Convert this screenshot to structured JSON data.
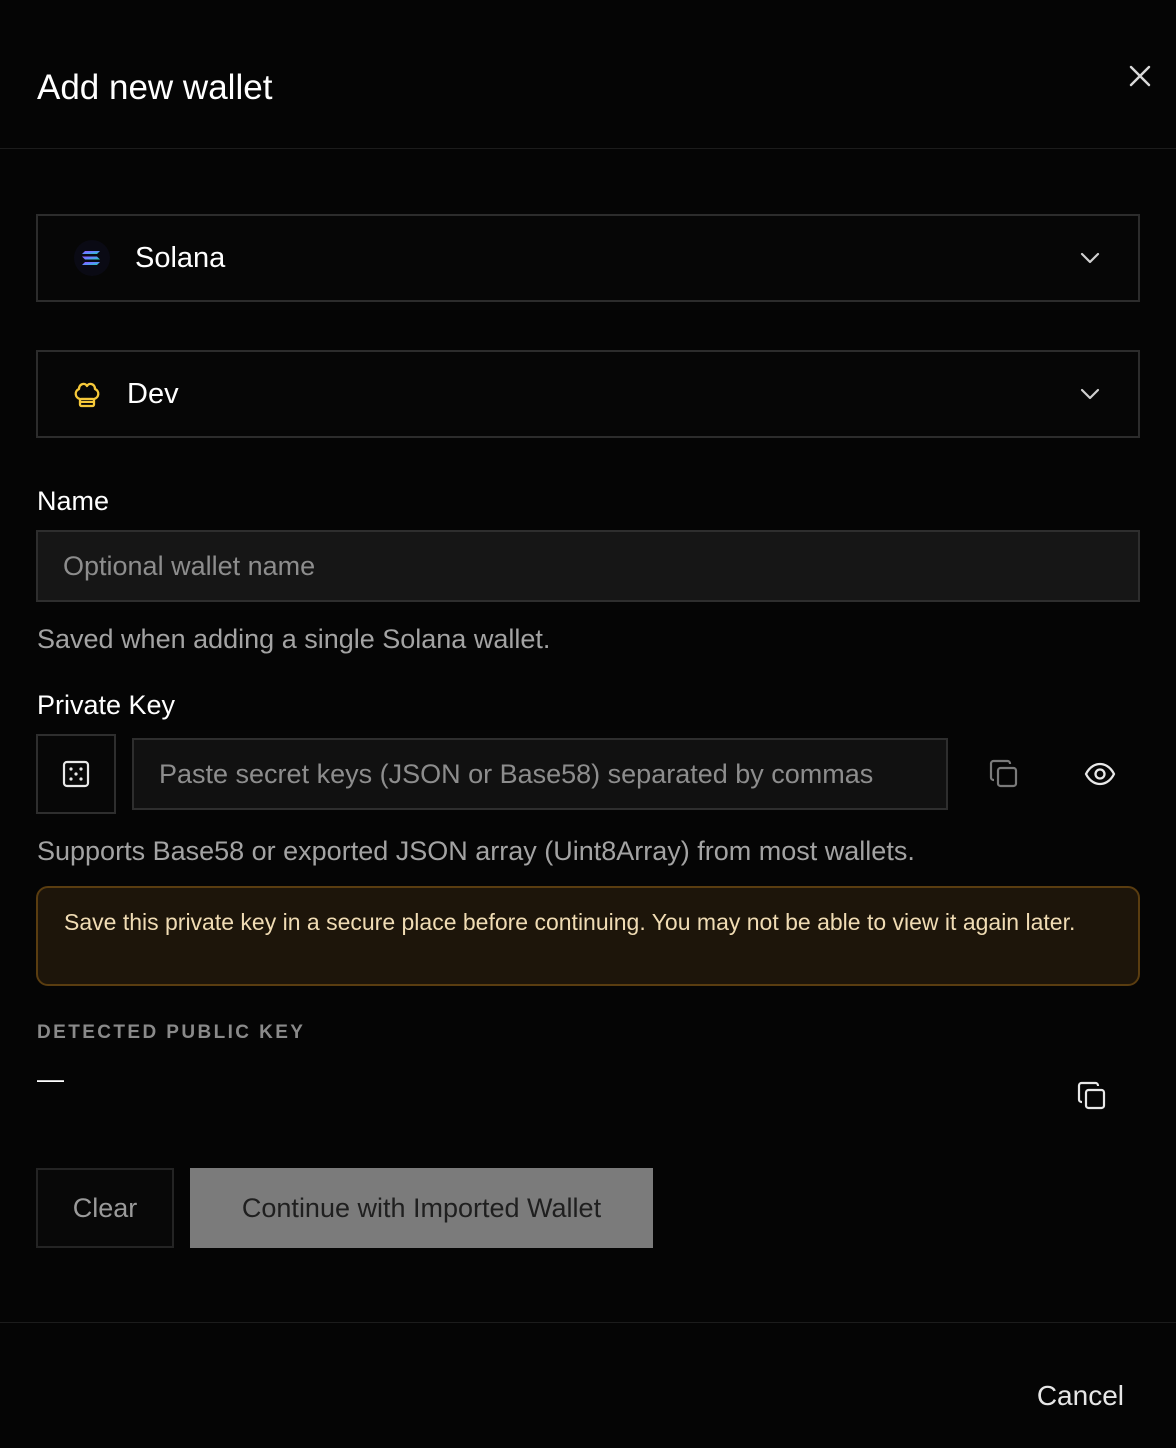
{
  "dialog": {
    "title": "Add new wallet",
    "close_icon": "close-icon"
  },
  "chain_select": {
    "selected": "Solana",
    "icon": "solana-logo-icon",
    "chevron_icon": "chevron-down-icon"
  },
  "profile_select": {
    "selected": "Dev",
    "icon": "chef-hat-icon",
    "icon_color": "#f5c83a",
    "chevron_icon": "chevron-down-icon"
  },
  "name_field": {
    "label": "Name",
    "value": "",
    "placeholder": "Optional wallet name",
    "help": "Saved when adding a single Solana wallet."
  },
  "private_key_field": {
    "label": "Private Key",
    "generate_icon": "dice-icon",
    "value": "",
    "placeholder": "Paste secret keys (JSON or Base58) separated by commas",
    "copy_icon": "copy-icon",
    "reveal_icon": "eye-icon",
    "help": "Supports Base58 or exported JSON array (Uint8Array) from most wallets."
  },
  "warning": {
    "text": "Save this private key in a secure place before continuing. You may not be able to view it again later.",
    "background_color": "#1d150a",
    "border_color": "#5a3d10"
  },
  "detected_public_key": {
    "label": "DETECTED PUBLIC KEY",
    "value": "—",
    "copy_icon": "copy-icon"
  },
  "actions": {
    "clear_label": "Clear",
    "continue_label": "Continue with Imported Wallet",
    "cancel_label": "Cancel"
  }
}
